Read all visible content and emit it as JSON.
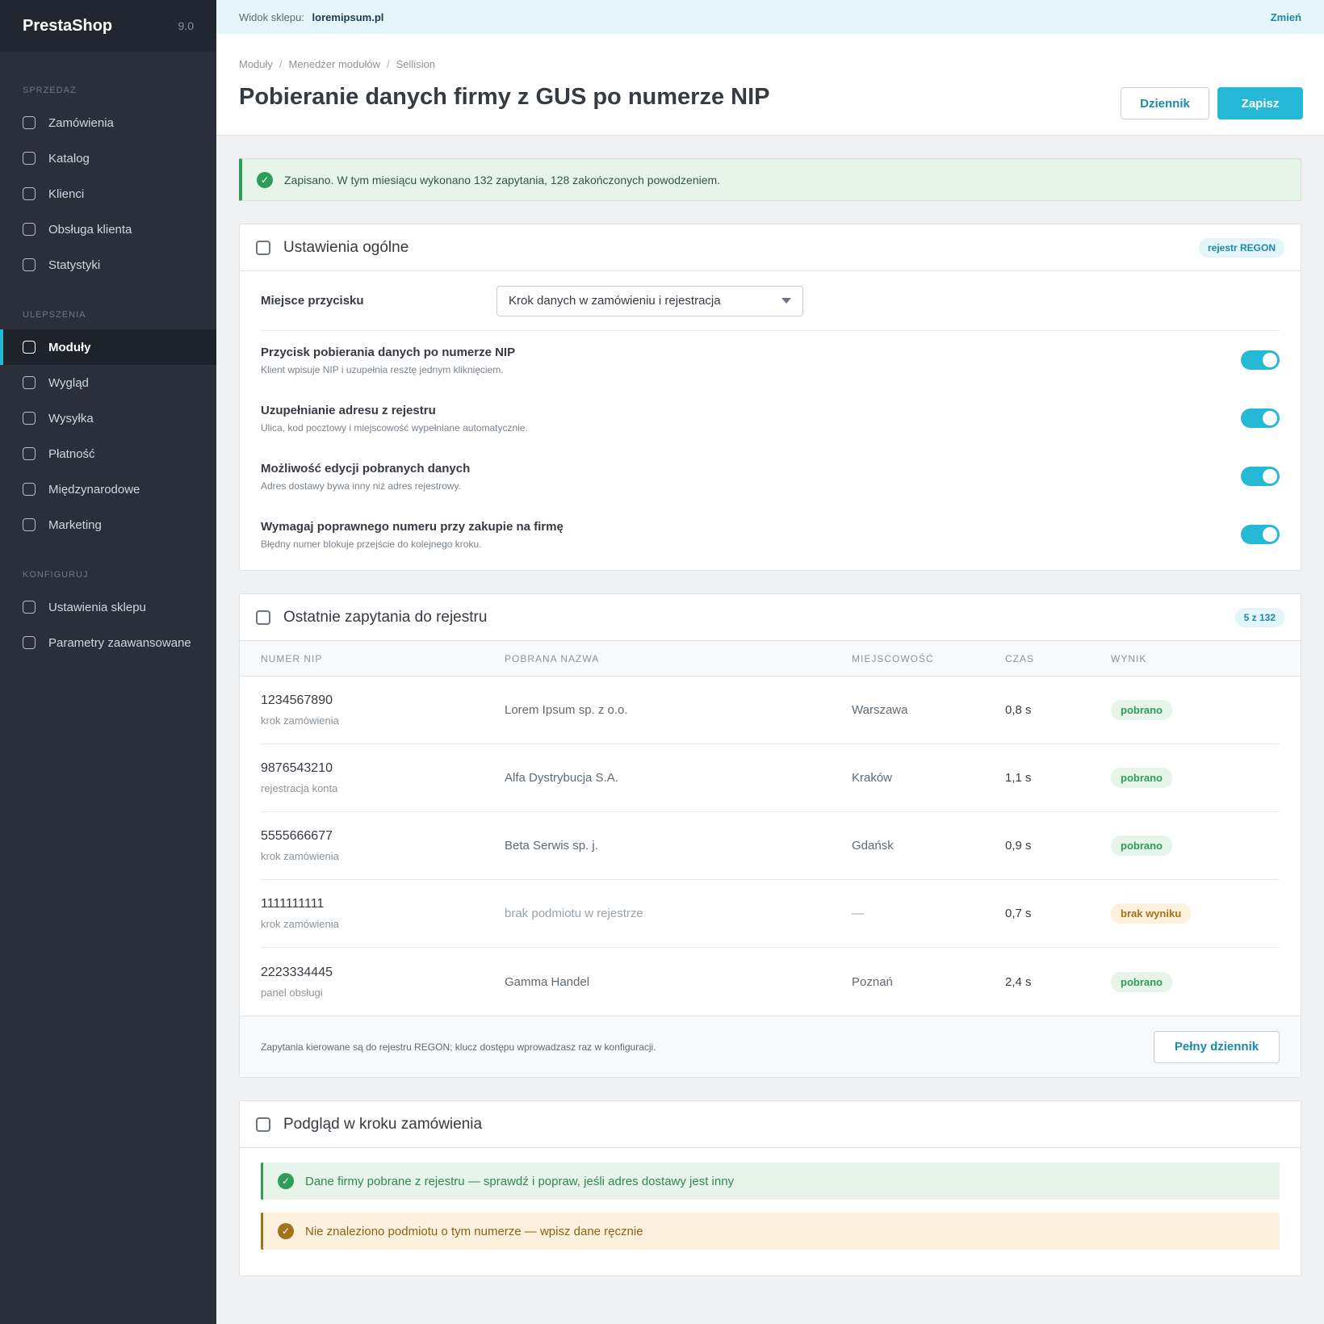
{
  "brand": {
    "name": "PrestaShop",
    "version": "9.0"
  },
  "sidebar": {
    "groups": [
      {
        "heading": "SPRZEDAŻ",
        "items": [
          "Zamówienia",
          "Katalog",
          "Klienci",
          "Obsługa klienta",
          "Statystyki"
        ]
      },
      {
        "heading": "ULEPSZENIA",
        "items": [
          "Moduły",
          "Wygląd",
          "Wysyłka",
          "Płatność",
          "Międzynarodowe",
          "Marketing"
        ]
      },
      {
        "heading": "KONFIGURUJ",
        "items": [
          "Ustawienia sklepu",
          "Parametry zaawansowane"
        ]
      }
    ],
    "active_item": "Moduły"
  },
  "topbar": {
    "store_label": "Widok sklepu:",
    "store_url": "loremipsum.pl",
    "change_label": "Zmień"
  },
  "header": {
    "breadcrumb": [
      "Moduły",
      "Menedżer modułów",
      "Sellision"
    ],
    "title": "Pobieranie danych firmy z GUS po numerze NIP",
    "log_label": "Dziennik",
    "save_label": "Zapisz"
  },
  "alert": {
    "text": "Zapisano. W tym miesiącu wykonano 132 zapytania, 128 zakończonych powodzeniem."
  },
  "general": {
    "title": "Ustawienia ogólne",
    "pill": "rejestr REGON",
    "button_place_label": "Miejsce przycisku",
    "button_place_value": "Krok danych w zamówieniu i rejestracja",
    "toggles": [
      {
        "title": "Przycisk pobierania danych po numerze NIP",
        "sub": "Klient wpisuje NIP i uzupełnia resztę jednym kliknięciem.",
        "on": true
      },
      {
        "title": "Uzupełnianie adresu z rejestru",
        "sub": "Ulica, kod pocztowy i miejscowość wypełniane automatycznie.",
        "on": true
      },
      {
        "title": "Możliwość edycji pobranych danych",
        "sub": "Adres dostawy bywa inny niż adres rejestrowy.",
        "on": true
      },
      {
        "title": "Wymagaj poprawnego numeru przy zakupie na firmę",
        "sub": "Błędny numer blokuje przejście do kolejnego kroku.",
        "on": true
      }
    ]
  },
  "queries": {
    "title": "Ostatnie zapytania do rejestru",
    "pill": "5 z 132",
    "columns": [
      "NUMER NIP",
      "POBRANA NAZWA",
      "MIEJSCOWOŚĆ",
      "CZAS",
      "WYNIK"
    ],
    "rows": [
      {
        "nip": "1234567890",
        "source": "krok zamówienia",
        "name": "Lorem Ipsum sp. z o.o.",
        "city": "Warszawa",
        "time": "0,8 s",
        "result": "pobrano",
        "status": "ok"
      },
      {
        "nip": "9876543210",
        "source": "rejestracja konta",
        "name": "Alfa Dystrybucja S.A.",
        "city": "Kraków",
        "time": "1,1 s",
        "result": "pobrano",
        "status": "ok"
      },
      {
        "nip": "5555666677",
        "source": "krok zamówienia",
        "name": "Beta Serwis sp. j.",
        "city": "Gdańsk",
        "time": "0,9 s",
        "result": "pobrano",
        "status": "ok"
      },
      {
        "nip": "1111111111",
        "source": "krok zamówienia",
        "name": "brak podmiotu w rejestrze",
        "city": "—",
        "time": "0,7 s",
        "result": "brak wyniku",
        "status": "no"
      },
      {
        "nip": "2223334445",
        "source": "panel obsługi",
        "name": "Gamma Handel",
        "city": "Poznań",
        "time": "2,4 s",
        "result": "pobrano",
        "status": "ok"
      }
    ],
    "footer_note": "Zapytania kierowane są do rejestru REGON; klucz dostępu wprowadzasz raz w konfiguracji.",
    "full_log_label": "Pełny dziennik"
  },
  "preview": {
    "title": "Podgląd w kroku zamówienia",
    "success_text": "Dane firmy pobrane z rejestru — sprawdź i popraw, jeśli adres dostawy jest inny",
    "warning_text": "Nie znaleziono podmiotu o tym numerze — wpisz dane ręcznie"
  },
  "colors": {
    "accent": "#25b9d7",
    "sidebar": "#2a2f3a",
    "success": "#2e9d57",
    "warning": "#a1741c"
  }
}
